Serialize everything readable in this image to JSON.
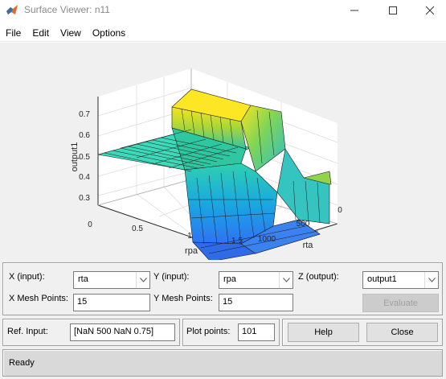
{
  "window": {
    "title": "Surface Viewer: n11",
    "icon": "matlab-logo-icon",
    "controls": [
      "minimize-icon",
      "maximize-icon",
      "close-icon"
    ]
  },
  "menu": {
    "items": [
      {
        "label": "File"
      },
      {
        "label": "Edit"
      },
      {
        "label": "View"
      },
      {
        "label": "Options"
      }
    ]
  },
  "plot": {
    "z_axis_label": "output1",
    "x_axis_label": "rpa",
    "y_axis_label": "rta",
    "z_ticks": [
      "0.3",
      "0.4",
      "0.5",
      "0.6",
      "0.7"
    ],
    "x_ticks": [
      "0",
      "0.5",
      "1",
      "1.5"
    ],
    "y_ticks": [
      "0",
      "500",
      "1000"
    ],
    "colormap": "parula"
  },
  "controls": {
    "x_input_label": "X (input):",
    "x_input_value": "rta",
    "y_input_label": "Y (input):",
    "y_input_value": "rpa",
    "z_output_label": "Z (output):",
    "z_output_value": "output1",
    "x_mesh_label": "X Mesh Points:",
    "x_mesh_value": "15",
    "y_mesh_label": "Y Mesh Points:",
    "y_mesh_value": "15",
    "evaluate_label": "Evaluate",
    "ref_input_label": "Ref. Input:",
    "ref_input_value": "[NaN 500 NaN 0.75]",
    "plot_points_label": "Plot points:",
    "plot_points_value": "101",
    "help_label": "Help",
    "close_label": "Close"
  },
  "status": {
    "text": "Ready"
  }
}
